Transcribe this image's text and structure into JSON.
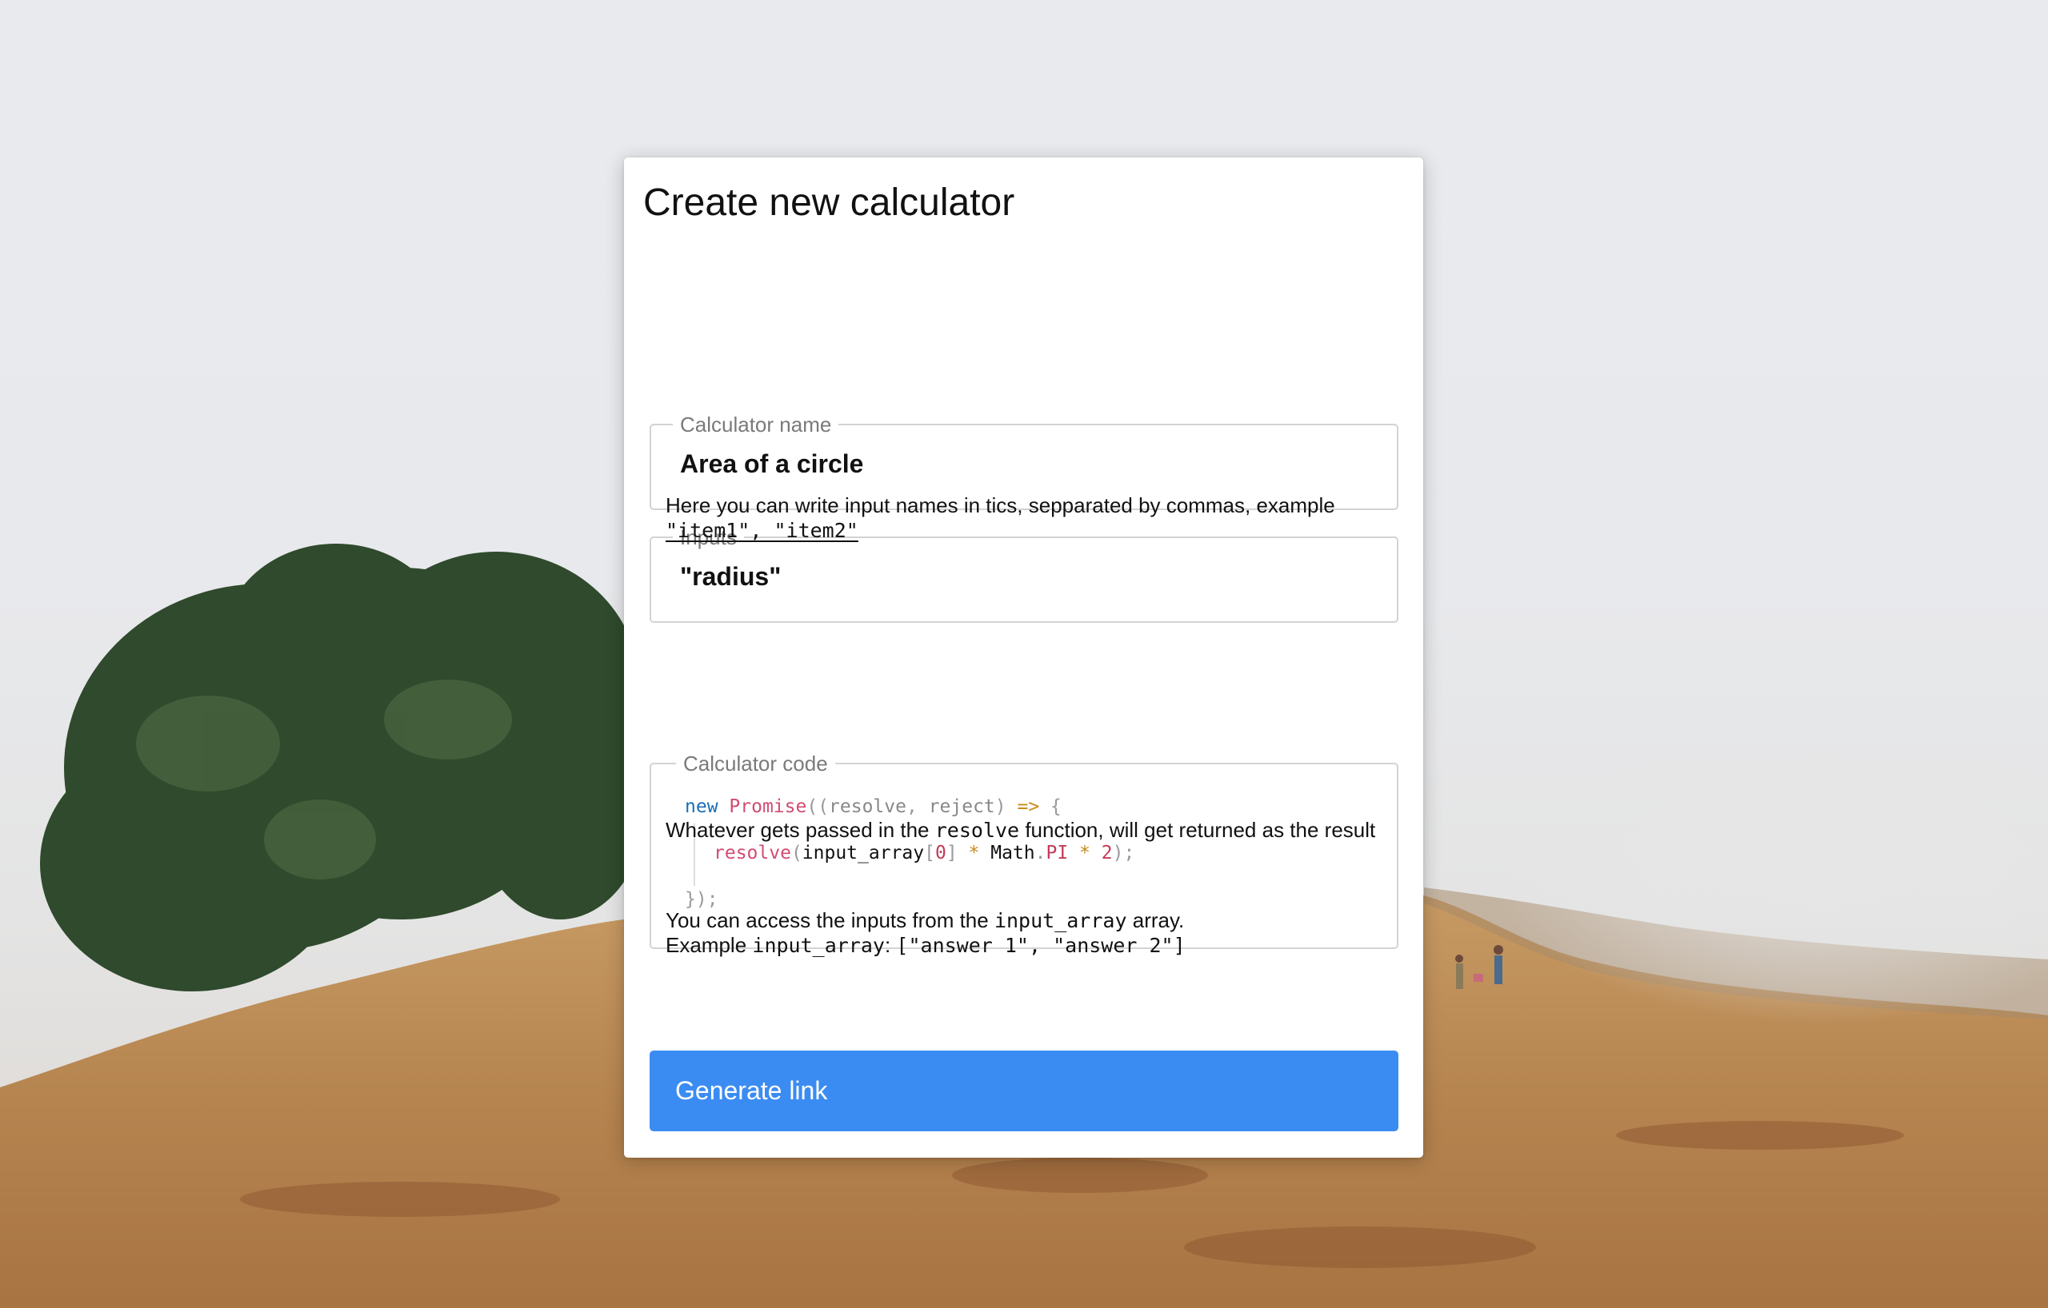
{
  "card": {
    "title": "Create new calculator"
  },
  "calculator_name": {
    "label": "Calculator name",
    "value": "Area of a circle"
  },
  "inputs": {
    "label": "Inputs",
    "value": "\"radius\"",
    "help_text": "Here you can write input names in tics, sepparated by commas, example",
    "help_example": "\"item1\", \"item2\""
  },
  "calculator_code": {
    "label": "Calculator code",
    "line1": {
      "keyword": "new",
      "class_name": "Promise",
      "open_paren": "((",
      "param_resolve": "resolve",
      "comma": ", ",
      "param_reject": "reject",
      "close_paren": ") ",
      "arrow": "=>",
      "brace": " {"
    },
    "line2": {
      "call": "resolve",
      "open": "(",
      "array": "input_array",
      "lbracket": "[",
      "index": "0",
      "rbracket": "]",
      "times1": " * ",
      "object": "Math",
      "dot": ".",
      "property": "PI",
      "times2": " * ",
      "factor": "2",
      "close": ");"
    },
    "line3": "});"
  },
  "help_resolve": {
    "before": "Whatever gets passed in the ",
    "code": "resolve",
    "after": " function, will get returned as the result"
  },
  "help_array": {
    "line1_before": "You can access the inputs from the ",
    "line1_code": "input_array",
    "line1_after": " array.",
    "line2_before": "Example ",
    "line2_code": "input_array",
    "line2_colon": ": ",
    "line2_example": "[\"answer 1\", \"answer 2\"]"
  },
  "actions": {
    "generate_label": "Generate link"
  },
  "colors": {
    "button": "#3b8cf2",
    "keyword": "#1a6fb5",
    "function": "#d24c72",
    "field_border": "#d3d3d3"
  }
}
